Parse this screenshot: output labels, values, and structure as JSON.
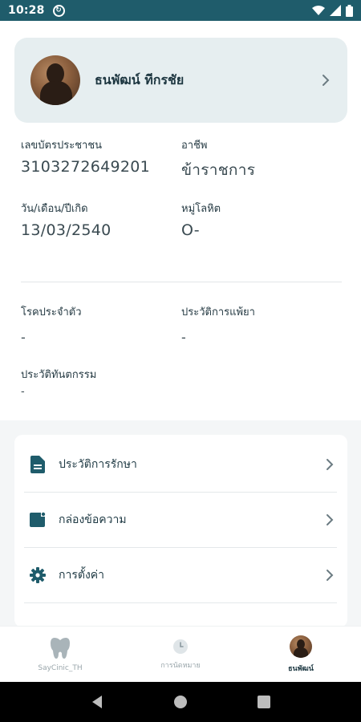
{
  "status_bar": {
    "time": "10:28",
    "icons": [
      "sync-icon",
      "wifi-icon",
      "signal-icon",
      "battery-icon"
    ]
  },
  "profile": {
    "name": "ธนพัฒน์ ทีกรชัย"
  },
  "personal_info": {
    "id_label": "เลขบัตรประชาชน",
    "id_value": "3103272649201",
    "occupation_label": "อาชีพ",
    "occupation_value": "ข้าราชการ",
    "dob_label": "วัน/เดือน/ปีเกิด",
    "dob_value": "13/03/2540",
    "blood_label": "หมู่โลหิต",
    "blood_value": "O-"
  },
  "medical_info": {
    "disease_label": "โรคประจำตัว",
    "disease_value": "-",
    "allergy_label": "ประวัติการแพ้ยา",
    "allergy_value": "-",
    "dental_label": "ประวัติทันตกรรม",
    "dental_value": "-"
  },
  "menu": {
    "items": [
      {
        "label": "ประวัติการรักษา",
        "icon": "document-icon"
      },
      {
        "label": "กล่องข้อความ",
        "icon": "message-icon"
      },
      {
        "label": "การตั้งค่า",
        "icon": "gear-icon"
      }
    ]
  },
  "bottom_nav": {
    "items": [
      {
        "label": "SayCinic_TH",
        "icon": "tooth-icon"
      },
      {
        "label": "การนัดหมาย",
        "icon": "clock-icon"
      },
      {
        "label": "ธนพัฒน์",
        "icon": "avatar"
      }
    ],
    "active_index": 2
  },
  "colors": {
    "status_bar": "#1f5c6b",
    "accent": "#1f5c6b",
    "card_bg": "#e6eef0"
  }
}
